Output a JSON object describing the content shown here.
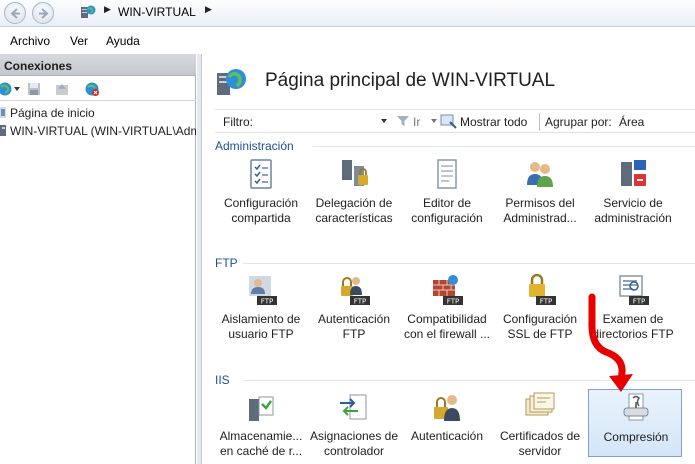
{
  "address": {
    "breadcrumb": "WIN-VIRTUAL"
  },
  "menu": {
    "items": [
      "Archivo",
      "Ver",
      "Ayuda"
    ]
  },
  "connections": {
    "title": "Conexiones",
    "tree": [
      {
        "label": "Página de inicio"
      },
      {
        "label": "WIN-VIRTUAL (WIN-VIRTUAL\\Administrador)"
      }
    ]
  },
  "main": {
    "title": "Página principal de WIN-VIRTUAL",
    "filter": {
      "label": "Filtro:",
      "value": "",
      "go_label": "Ir",
      "show_all_label": "Mostrar todo",
      "group_by_label": "Agrupar por:",
      "group_by_value": "Área"
    },
    "sections": [
      {
        "title": "Administración",
        "items": [
          {
            "label1": "Configuración",
            "label2": "compartida",
            "icon": "shared-config-icon"
          },
          {
            "label1": "Delegación de",
            "label2": "características",
            "icon": "feature-delegation-icon"
          },
          {
            "label1": "Editor de",
            "label2": "configuración",
            "icon": "config-editor-icon"
          },
          {
            "label1": "Permisos del",
            "label2": "Administrad...",
            "icon": "manager-permissions-icon"
          },
          {
            "label1": "Servicio de",
            "label2": "administración",
            "icon": "management-service-icon"
          }
        ]
      },
      {
        "title": "FTP",
        "items": [
          {
            "label1": "Aislamiento de",
            "label2": "usuario FTP",
            "icon": "ftp-user-isolation-icon"
          },
          {
            "label1": "Autenticación",
            "label2": "FTP",
            "icon": "ftp-authentication-icon"
          },
          {
            "label1": "Compatibilidad",
            "label2": "con el firewall ...",
            "icon": "ftp-firewall-icon"
          },
          {
            "label1": "Configuración",
            "label2": "SSL de FTP",
            "icon": "ftp-ssl-icon"
          },
          {
            "label1": "Examen de",
            "label2": "directorios FTP",
            "icon": "ftp-directory-browsing-icon"
          }
        ]
      },
      {
        "title": "IIS",
        "items": [
          {
            "label1": "Almacenamie...",
            "label2": "en caché de r...",
            "icon": "output-caching-icon"
          },
          {
            "label1": "Asignaciones de",
            "label2": "controlador",
            "icon": "handler-mappings-icon"
          },
          {
            "label1": "Autenticación",
            "label2": "",
            "icon": "authentication-icon"
          },
          {
            "label1": "Certificados de",
            "label2": "servidor",
            "icon": "server-certificates-icon"
          },
          {
            "label1": "Compresión",
            "label2": "",
            "icon": "compression-icon",
            "selected": true
          }
        ]
      }
    ]
  },
  "colors": {
    "section_title": "#1f4e9c",
    "selection": "#d3e5f7",
    "annotation_arrow": "#e60000"
  }
}
